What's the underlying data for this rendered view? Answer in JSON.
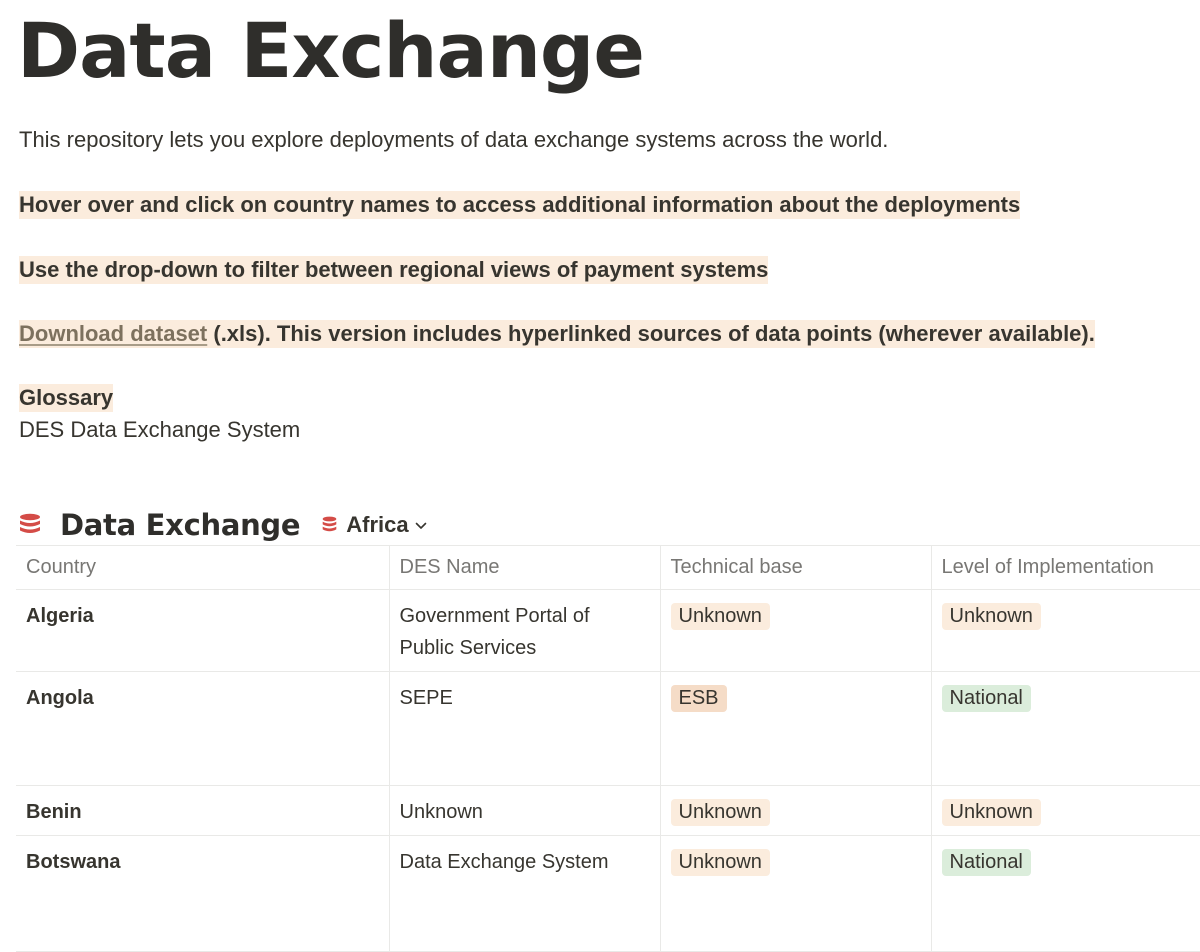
{
  "page": {
    "title": "Data Exchange",
    "intro": "This repository lets you explore deployments of data exchange systems across the world.",
    "hover_tip": "Hover over and click on country names to access additional information about the deployments",
    "dropdown_tip": "Use the drop-down to filter between regional views of payment systems",
    "download_link": "Download dataset",
    "download_rest": " (.xls). This version includes hyperlinked sources of data points (wherever available).",
    "glossary_heading": "Glossary",
    "glossary_entry": "DES Data Exchange System"
  },
  "database": {
    "title": "Data Exchange",
    "icon": "database-icon",
    "view": "Africa",
    "columns": [
      "Country",
      "DES Name",
      "Technical base",
      "Level of Implementation"
    ],
    "rows": [
      {
        "country": "Algeria",
        "des_name": "Government Portal of Public Services",
        "technical_base": "Unknown",
        "level": "Unknown"
      },
      {
        "country": "Angola",
        "des_name": "SEPE",
        "technical_base": "ESB",
        "level": "National"
      },
      {
        "country": "Benin",
        "des_name": "Unknown",
        "technical_base": "Unknown",
        "level": "Unknown"
      },
      {
        "country": "Botswana",
        "des_name": "Data Exchange System",
        "technical_base": "Unknown",
        "level": "National"
      }
    ]
  },
  "colors": {
    "highlight": "#fbecdd",
    "tag_orange": "#fbecdd",
    "tag_esb": "#f5dcc7",
    "tag_green": "#dbeddb",
    "db_icon_red": "#d44c47",
    "text": "#37352f",
    "muted": "#787774"
  }
}
